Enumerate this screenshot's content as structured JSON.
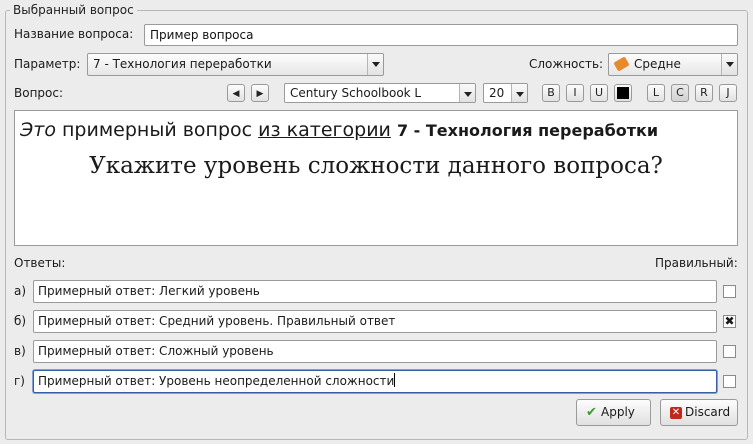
{
  "group": {
    "title": "Выбранный вопрос"
  },
  "name_row": {
    "label": "Название вопроса:",
    "value": "Пример вопроса"
  },
  "param_row": {
    "label": "Параметр:",
    "value": "7 - Технология переработки",
    "difficulty_label": "Сложность:",
    "difficulty_value": "Средне"
  },
  "toolbar": {
    "label": "Вопрос:",
    "prev": "◀",
    "next": "▶",
    "font": "Century Schoolbook L",
    "size": "20",
    "bold": "B",
    "italic": "I",
    "underline": "U",
    "align_left": "L",
    "align_center": "C",
    "align_right": "R",
    "align_justify": "J",
    "color": "#000000"
  },
  "editor": {
    "line1_italic": "Это",
    "line1_normal": " примерный вопрос ",
    "line1_underline": "из категории",
    "line1_bold": "7 - Технология переработки",
    "line2": "Укажите уровень сложности данного вопроса?"
  },
  "answers_header": {
    "left": "Ответы:",
    "right": "Правильный:"
  },
  "answers": [
    {
      "letter": "а)",
      "text": "Примерный ответ: Легкий уровень",
      "correct": false
    },
    {
      "letter": "б)",
      "text": "Примерный ответ: Средний уровень. Правильный ответ",
      "correct": true
    },
    {
      "letter": "в)",
      "text": "Примерный ответ: Сложный уровень",
      "correct": false
    },
    {
      "letter": "г)",
      "text": "Примерный ответ: Уровень неопределенной сложности",
      "correct": false
    }
  ],
  "buttons": {
    "apply": "Apply",
    "discard": "Discard"
  },
  "icons": {
    "difficulty": "eraser-icon",
    "apply": "check-icon",
    "discard": "cross-icon"
  },
  "colors": {
    "focus": "#3a5ea5",
    "apply_icon": "#3e9a2f",
    "discard_icon": "#c0281e",
    "difficulty_icon": "#e8892a"
  }
}
